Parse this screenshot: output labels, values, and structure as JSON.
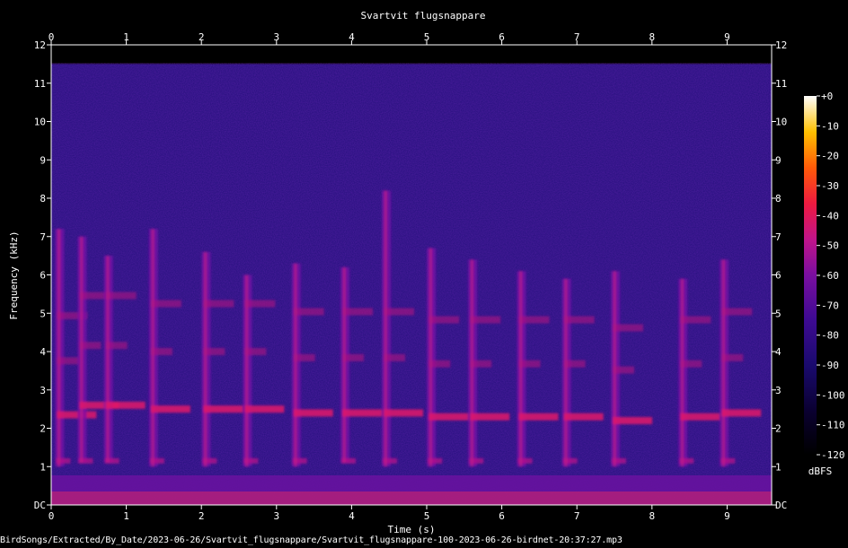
{
  "chart_data": {
    "type": "heatmap",
    "title": "Svartvit flugsnappare",
    "xlabel": "Time (s)",
    "ylabel": "Frequency (kHz)",
    "xlim": [
      0,
      9.6
    ],
    "ylim": [
      0,
      12
    ],
    "x_ticks": [
      "0",
      "1",
      "2",
      "3",
      "4",
      "5",
      "6",
      "7",
      "8",
      "9"
    ],
    "y_ticks": [
      "DC",
      "1",
      "2",
      "3",
      "4",
      "5",
      "6",
      "7",
      "8",
      "9",
      "10",
      "11",
      "12"
    ],
    "colorbar": {
      "label": "dBFS",
      "range": [
        -120,
        0
      ],
      "ticks": [
        "+0",
        "-10",
        "-20",
        "-30",
        "-40",
        "-50",
        "-60",
        "-70",
        "-80",
        "-90",
        "-100",
        "-110",
        "-120"
      ]
    },
    "background_dbfs": -95,
    "content_upper_khz": 11.5,
    "notes": [
      {
        "t": 0.1,
        "lo": 1.0,
        "hi": 7.2,
        "band": 2.35
      },
      {
        "t": 0.4,
        "lo": 1.1,
        "hi": 7.0,
        "band": 2.6
      },
      {
        "t": 0.75,
        "lo": 1.1,
        "hi": 6.5,
        "band": 2.6
      },
      {
        "t": 1.35,
        "lo": 1.0,
        "hi": 7.2,
        "band": 2.5
      },
      {
        "t": 2.05,
        "lo": 1.0,
        "hi": 6.6,
        "band": 2.5
      },
      {
        "t": 2.6,
        "lo": 1.0,
        "hi": 6.0,
        "band": 2.5
      },
      {
        "t": 3.25,
        "lo": 1.0,
        "hi": 6.3,
        "band": 2.4
      },
      {
        "t": 3.9,
        "lo": 1.1,
        "hi": 6.2,
        "band": 2.4
      },
      {
        "t": 4.45,
        "lo": 1.0,
        "hi": 8.2,
        "band": 2.4
      },
      {
        "t": 5.05,
        "lo": 1.0,
        "hi": 6.7,
        "band": 2.3
      },
      {
        "t": 5.6,
        "lo": 1.0,
        "hi": 6.4,
        "band": 2.3
      },
      {
        "t": 6.25,
        "lo": 1.0,
        "hi": 6.1,
        "band": 2.3
      },
      {
        "t": 6.85,
        "lo": 1.0,
        "hi": 5.9,
        "band": 2.3
      },
      {
        "t": 7.5,
        "lo": 1.0,
        "hi": 6.1,
        "band": 2.2
      },
      {
        "t": 8.4,
        "lo": 1.0,
        "hi": 5.9,
        "band": 2.3
      },
      {
        "t": 8.95,
        "lo": 1.0,
        "hi": 6.4,
        "band": 2.4
      }
    ]
  },
  "footer_path": "BirdSongs/Extracted/By_Date/2023-06-26/Svartvit_flugsnappare/Svartvit_flugsnappare-100-2023-06-26-birdnet-20:37:27.mp3"
}
